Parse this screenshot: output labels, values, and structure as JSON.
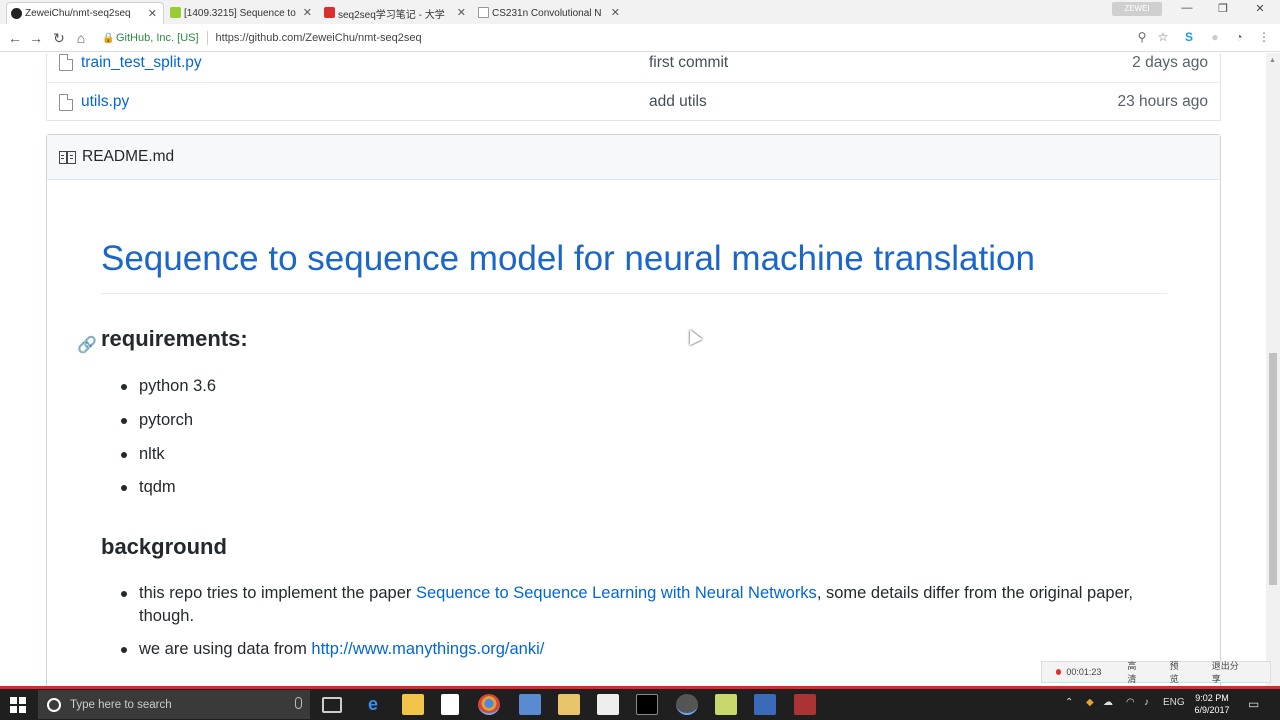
{
  "browser": {
    "tabs": [
      {
        "title": "ZeweiChu/nmt-seq2seq",
        "favicon_color": "#222222"
      },
      {
        "title": "[1409.3215] Sequence to",
        "favicon_color": "#9acd32"
      },
      {
        "title": "seq2seq学习笔记 - 大学",
        "favicon_color": "#d9302f"
      },
      {
        "title": "CS231n Convolutional N",
        "favicon_color": "#aaaaaa"
      }
    ],
    "user_chip": "ZEWEI",
    "cert": "GitHub, Inc. [US]",
    "url": "https://github.com/ZeweiChu/nmt-seq2seq"
  },
  "files": [
    {
      "name": "train_test_split.py",
      "message": "first commit",
      "age": "2 days ago"
    },
    {
      "name": "utils.py",
      "message": "add utils",
      "age": "23 hours ago"
    }
  ],
  "readme": {
    "filename": "README.md",
    "title": "Sequence to sequence model for neural machine translation",
    "requirements_heading": "requirements:",
    "requirements": [
      "python 3.6",
      "pytorch",
      "nltk",
      "tqdm"
    ],
    "background_heading": "background",
    "bg1_pre": "this repo tries to implement the paper ",
    "bg1_link": "Sequence to Sequence Learning with Neural Networks",
    "bg1_post": ", some details differ from the original paper, though.",
    "bg2_pre": "we are using data from ",
    "bg2_link": "http://www.manythings.org/anki/"
  },
  "recorder": {
    "timer": "00:01:23",
    "hd": "高清",
    "preview": "预览",
    "exit": "退出分享"
  },
  "taskbar": {
    "search_placeholder": "Type here to search",
    "lang": "ENG",
    "time": "9:02 PM",
    "date": "6/9/2017"
  },
  "colors": {
    "link": "#0366d6",
    "heading_blue": "#1a66c9",
    "taskbar": "#1f1f1f"
  }
}
